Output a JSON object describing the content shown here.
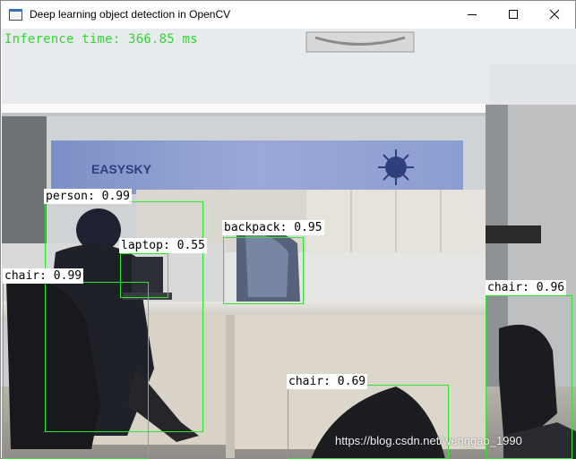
{
  "window": {
    "title": "Deep learning object detection in OpenCV"
  },
  "overlay": {
    "inference_text": "Inference time: 366.85  ms",
    "inference_color": "#33d633",
    "watermark": "https://blog.csdn.net/wenggao_1990"
  },
  "detections": [
    {
      "label": "person: 0.99"
    },
    {
      "label": "laptop: 0.55"
    },
    {
      "label": "backpack: 0.95"
    },
    {
      "label": "chair: 0.99"
    },
    {
      "label": "chair: 0.96"
    },
    {
      "label": "chair: 0.69"
    }
  ],
  "colors": {
    "box": "#2ee62e",
    "label_bg": "#ffffff"
  },
  "scene_sign": "EASYSKY"
}
